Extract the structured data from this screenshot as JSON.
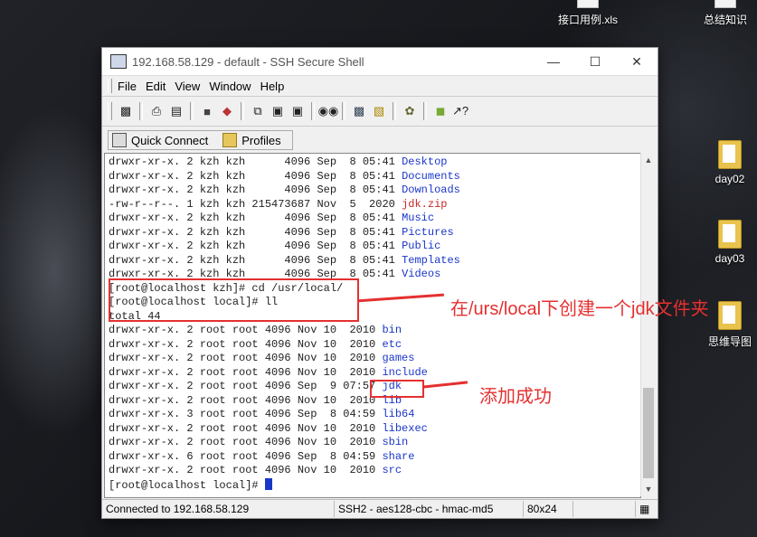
{
  "desktop": {
    "icons": [
      {
        "label": "接口用例.xls"
      },
      {
        "label": "总结知识"
      },
      {
        "label": "day02"
      },
      {
        "label": "day03"
      },
      {
        "label": "思维导图"
      }
    ]
  },
  "window": {
    "title": "192.168.58.129 - default - SSH Secure Shell",
    "controls": {
      "minimize": "—",
      "maximize": "☐",
      "close": "✕"
    }
  },
  "menu": [
    "File",
    "Edit",
    "View",
    "Window",
    "Help"
  ],
  "toolbar_icons": [
    "save-icon",
    "print-icon",
    "print-preview-icon",
    "new-window-icon",
    "disconnect-icon",
    "copy-icon",
    "paste-icon",
    "paste2-icon",
    "find-icon",
    "settings-icon",
    "file-transfer-icon",
    "profile-icon",
    "help-book-icon",
    "context-help-icon"
  ],
  "quickbar": {
    "quick_connect": "Quick Connect",
    "profiles": "Profiles"
  },
  "terminal": {
    "lines_top": [
      {
        "perm": "drwxr-xr-x. 2 kzh kzh      4096 Sep  8 05:41 ",
        "name": "Desktop",
        "color": "blue"
      },
      {
        "perm": "drwxr-xr-x. 2 kzh kzh      4096 Sep  8 05:41 ",
        "name": "Documents",
        "color": "blue"
      },
      {
        "perm": "drwxr-xr-x. 2 kzh kzh      4096 Sep  8 05:41 ",
        "name": "Downloads",
        "color": "blue"
      },
      {
        "perm": "-rw-r--r--. 1 kzh kzh 215473687 Nov  5  2020 ",
        "name": "jdk.zip",
        "color": "red"
      },
      {
        "perm": "drwxr-xr-x. 2 kzh kzh      4096 Sep  8 05:41 ",
        "name": "Music",
        "color": "blue"
      },
      {
        "perm": "drwxr-xr-x. 2 kzh kzh      4096 Sep  8 05:41 ",
        "name": "Pictures",
        "color": "blue"
      },
      {
        "perm": "drwxr-xr-x. 2 kzh kzh      4096 Sep  8 05:41 ",
        "name": "Public",
        "color": "blue"
      },
      {
        "perm": "drwxr-xr-x. 2 kzh kzh      4096 Sep  8 05:41 ",
        "name": "Templates",
        "color": "blue"
      },
      {
        "perm": "drwxr-xr-x. 2 kzh kzh      4096 Sep  8 05:41 ",
        "name": "Videos",
        "color": "blue"
      }
    ],
    "cmd1": "[root@localhost kzh]# cd /usr/local/",
    "cmd2": "[root@localhost local]# ll",
    "total": "total 44",
    "lines_bottom": [
      {
        "perm": "drwxr-xr-x. 2 root root 4096 Nov 10  2010 ",
        "name": "bin"
      },
      {
        "perm": "drwxr-xr-x. 2 root root 4096 Nov 10  2010 ",
        "name": "etc"
      },
      {
        "perm": "drwxr-xr-x. 2 root root 4096 Nov 10  2010 ",
        "name": "games"
      },
      {
        "perm": "drwxr-xr-x. 2 root root 4096 Nov 10  2010 ",
        "name": "include"
      },
      {
        "perm": "drwxr-xr-x. 2 root root 4096 Sep  9 07:57 ",
        "name": "jdk"
      },
      {
        "perm": "drwxr-xr-x. 2 root root 4096 Nov 10  2010 ",
        "name": "lib"
      },
      {
        "perm": "drwxr-xr-x. 3 root root 4096 Sep  8 04:59 ",
        "name": "lib64"
      },
      {
        "perm": "drwxr-xr-x. 2 root root 4096 Nov 10  2010 ",
        "name": "libexec"
      },
      {
        "perm": "drwxr-xr-x. 2 root root 4096 Nov 10  2010 ",
        "name": "sbin"
      },
      {
        "perm": "drwxr-xr-x. 6 root root 4096 Sep  8 04:59 ",
        "name": "share"
      },
      {
        "perm": "drwxr-xr-x. 2 root root 4096 Nov 10  2010 ",
        "name": "src"
      }
    ],
    "prompt": "[root@localhost local]# "
  },
  "status": {
    "connected": "Connected to 192.168.58.129",
    "cipher": "SSH2 - aes128-cbc - hmac-md5",
    "size": "80x24"
  },
  "annotations": {
    "create_note": "在/urs/local下创建一个jdk文件夹",
    "success_note": "添加成功"
  },
  "colors": {
    "accent_red": "#e53030",
    "dir_blue": "#1a36c8",
    "file_red": "#c62828"
  }
}
